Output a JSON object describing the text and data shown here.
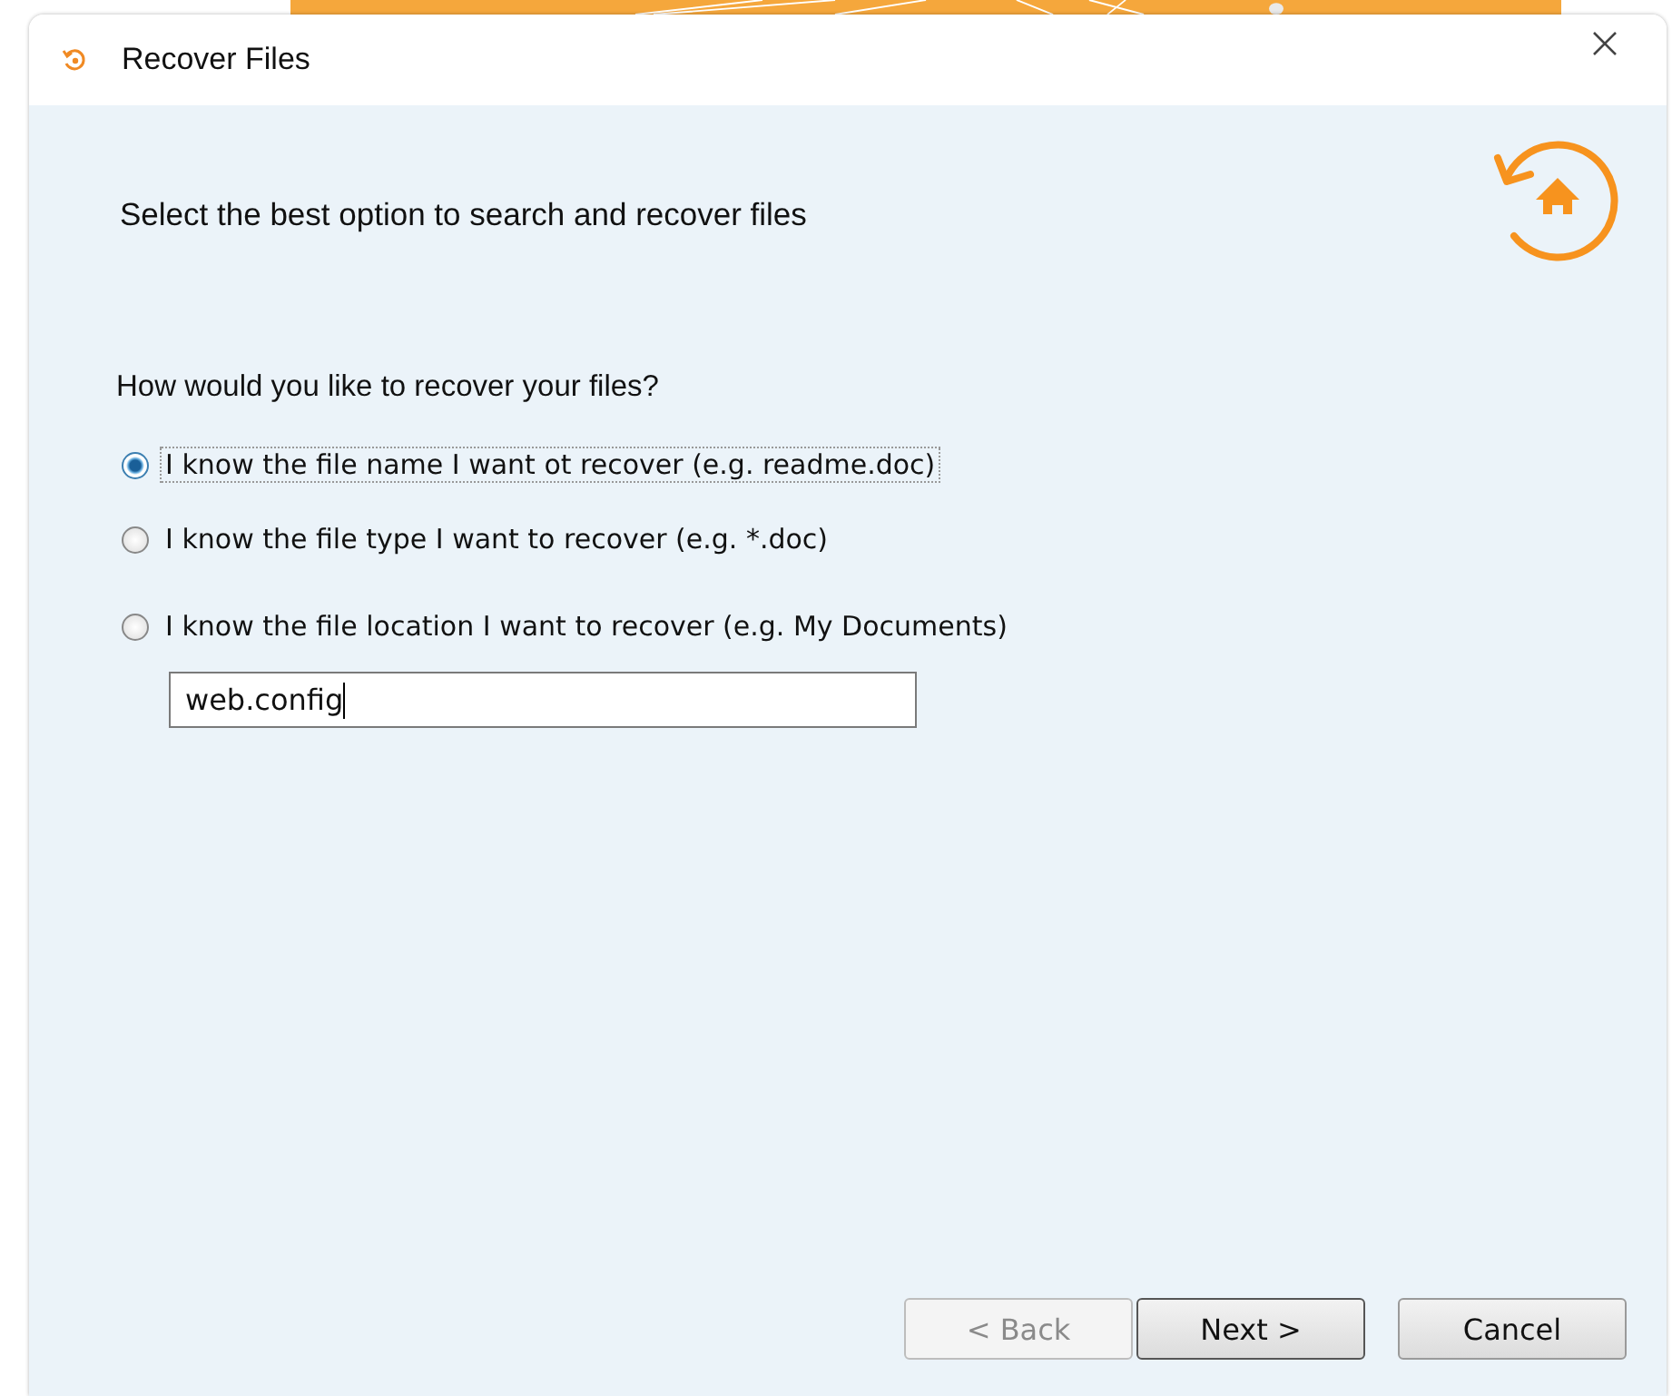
{
  "window": {
    "title": "Recover Files"
  },
  "heading": "Select the best option to search and recover files",
  "question": "How would you like to recover your files?",
  "options": [
    {
      "label": "I know the file name I want ot recover (e.g. readme.doc)",
      "selected": true
    },
    {
      "label": "I know the file type I want to recover (e.g. *.doc)",
      "selected": false
    },
    {
      "label": "I know the file location I want to recover (e.g. My Documents)",
      "selected": false
    }
  ],
  "filename_field": {
    "value": "web.config"
  },
  "buttons": [
    {
      "label": "< Back",
      "disabled": true,
      "default": false
    },
    {
      "label": "Next >",
      "disabled": false,
      "default": true
    },
    {
      "label": "Cancel",
      "disabled": false,
      "default": false
    }
  ]
}
